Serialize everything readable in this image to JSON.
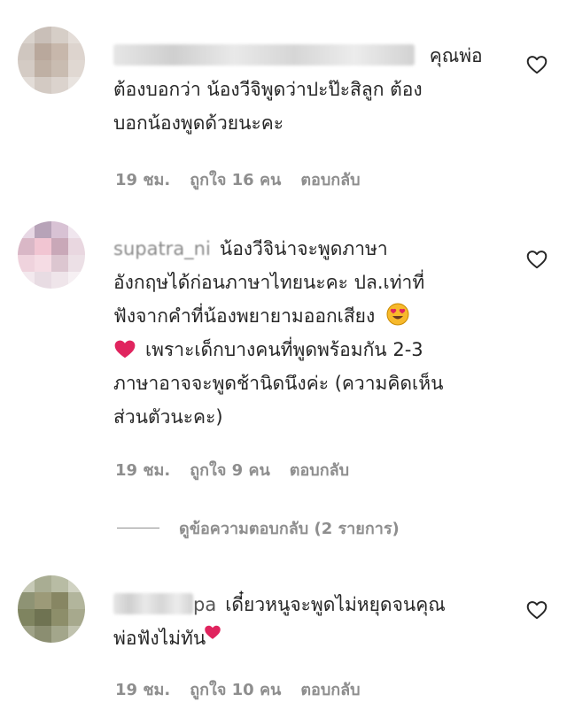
{
  "comments": [
    {
      "username_hidden": true,
      "text_lines": [
        "คุณพ่อ",
        "ต้องบอกว่า น้องวีจิพูดว่าปะป๊ะสิลูก ต้อง",
        "บอกน้องพูดด้วยนะคะ"
      ],
      "time": "19 ชม.",
      "likes": "ถูกใจ 16 คน",
      "reply": "ตอบกลับ"
    },
    {
      "username": "supatra_ni",
      "text_lines": [
        "น้องวีจิน่าจะพูดภาษา",
        "อังกฤษได้ก่อนภาษาไทยนะคะ ปล.เท่าที่",
        "ฟังจากคำที่น้องพยายามออกเสียง",
        "เพราะเด็กบางคนที่พูดพร้อมกัน 2-3",
        "ภาษาอาจจะพูดช้านิดนึงค่ะ (ความคิดเห็น",
        "ส่วนตัวนะคะ)"
      ],
      "time": "19 ชม.",
      "likes": "ถูกใจ 9 คน",
      "reply": "ตอบกลับ"
    },
    {
      "username_suffix": "pa",
      "text_lines": [
        "เดี๋ยวหนูจะพูดไม่หยุดจนคุณ",
        "พ่อฟังไม่ทัน"
      ],
      "time": "19 ชม.",
      "likes": "ถูกใจ 10 คน",
      "reply": "ตอบกลับ"
    }
  ],
  "view_replies": "ดูข้อความตอบกลับ (2 รายการ)",
  "icons": {
    "like": "heart-outline-icon",
    "emoji_love": "heart-eyes-emoji-icon",
    "red_heart": "red-heart-icon"
  },
  "colors": {
    "text": "#262626",
    "meta": "#8e8e8e",
    "heart_red": "#e0245e",
    "emoji_yellow": "#f7b92b"
  }
}
